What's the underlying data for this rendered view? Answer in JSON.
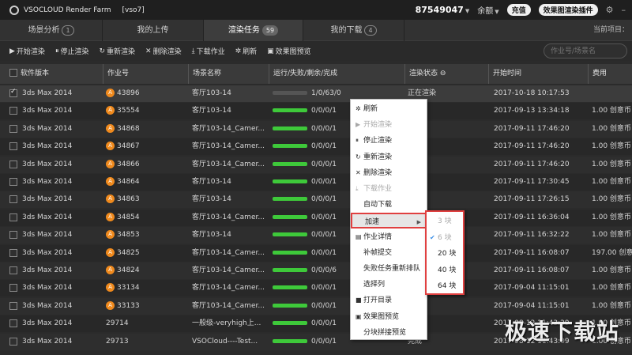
{
  "app": {
    "title": "VSOCLOUD Render Farm",
    "user_tag": "[vso7]"
  },
  "top": {
    "account": "87549047",
    "balance_label": "余额",
    "recharge": "充值",
    "plugin": "效果图渲染插件"
  },
  "tabs": [
    {
      "label": "场景分析",
      "count": "1"
    },
    {
      "label": "我的上传",
      "count": ""
    },
    {
      "label": "渲染任务",
      "count": "59"
    },
    {
      "label": "我的下载",
      "count": "4"
    }
  ],
  "current_project_label": "当前项目：",
  "toolbar": [
    {
      "icon": "▶",
      "label": "开始渲染"
    },
    {
      "icon": "⏸",
      "label": "停止渲染"
    },
    {
      "icon": "↻",
      "label": "重新渲染"
    },
    {
      "icon": "✕",
      "label": "删除渲染"
    },
    {
      "icon": "⤓",
      "label": "下载作业"
    },
    {
      "icon": "✲",
      "label": "刷新"
    },
    {
      "icon": "▣",
      "label": "效果图预览"
    }
  ],
  "search": {
    "placeholder": "作业号/场景名"
  },
  "columns": [
    "软件版本",
    "作业号",
    "场景名称",
    "运行/失败/剩余/完成",
    "渲染状态",
    "开始时间",
    "费用"
  ],
  "rows": [
    {
      "software": "3ds Max 2014",
      "badge": "A",
      "job": "43896",
      "scene": "客厅103-14",
      "progress": "1/0/63/0",
      "status": "正在渲染",
      "time": "2017-10-18 10:17:53",
      "cost": "",
      "checked": true,
      "bar_fill": 0.0
    },
    {
      "software": "3ds Max 2014",
      "badge": "A",
      "job": "35554",
      "scene": "客厅103-14",
      "progress": "0/0/0/1",
      "status": "",
      "time": "2017-09-13 13:34:18",
      "cost": "1.00 创意币",
      "checked": false,
      "bar_fill": 1.0
    },
    {
      "software": "3ds Max 2014",
      "badge": "A",
      "job": "34868",
      "scene": "客厅103-14_Camer...",
      "progress": "0/0/0/1",
      "status": "",
      "time": "2017-09-11 17:46:20",
      "cost": "1.00 创意币",
      "checked": false,
      "bar_fill": 1.0
    },
    {
      "software": "3ds Max 2014",
      "badge": "A",
      "job": "34867",
      "scene": "客厅103-14_Camer...",
      "progress": "0/0/0/1",
      "status": "",
      "time": "2017-09-11 17:46:20",
      "cost": "1.00 创意币",
      "checked": false,
      "bar_fill": 1.0
    },
    {
      "software": "3ds Max 2014",
      "badge": "A",
      "job": "34866",
      "scene": "客厅103-14_Camer...",
      "progress": "0/0/0/1",
      "status": "",
      "time": "2017-09-11 17:46:20",
      "cost": "1.00 创意币",
      "checked": false,
      "bar_fill": 1.0
    },
    {
      "software": "3ds Max 2014",
      "badge": "A",
      "job": "34864",
      "scene": "客厅103-14",
      "progress": "0/0/0/1",
      "status": "",
      "time": "2017-09-11 17:30:45",
      "cost": "1.00 创意币",
      "checked": false,
      "bar_fill": 1.0
    },
    {
      "software": "3ds Max 2014",
      "badge": "A",
      "job": "34863",
      "scene": "客厅103-14",
      "progress": "0/0/0/1",
      "status": "",
      "time": "2017-09-11 17:26:15",
      "cost": "1.00 创意币",
      "checked": false,
      "bar_fill": 1.0
    },
    {
      "software": "3ds Max 2014",
      "badge": "A",
      "job": "34854",
      "scene": "客厅103-14_Camer...",
      "progress": "0/0/0/1",
      "status": "",
      "time": "2017-09-11 16:36:04",
      "cost": "1.00 创意币",
      "checked": false,
      "bar_fill": 1.0
    },
    {
      "software": "3ds Max 2014",
      "badge": "A",
      "job": "34853",
      "scene": "客厅103-14",
      "progress": "0/0/0/1",
      "status": "",
      "time": "2017-09-11 16:32:22",
      "cost": "1.00 创意币",
      "checked": false,
      "bar_fill": 1.0
    },
    {
      "software": "3ds Max 2014",
      "badge": "A",
      "job": "34825",
      "scene": "客厅103-14_Camer...",
      "progress": "0/0/0/1",
      "status": "",
      "time": "2017-09-11 16:08:07",
      "cost": "197.00 创意币",
      "checked": false,
      "bar_fill": 1.0
    },
    {
      "software": "3ds Max 2014",
      "badge": "A",
      "job": "34824",
      "scene": "客厅103-14_Camer...",
      "progress": "0/0/0/6",
      "status": "",
      "time": "2017-09-11 16:08:07",
      "cost": "1.00 创意币",
      "checked": false,
      "bar_fill": 1.0
    },
    {
      "software": "3ds Max 2014",
      "badge": "A",
      "job": "33134",
      "scene": "客厅103-14_Camer...",
      "progress": "0/0/0/1",
      "status": "",
      "time": "2017-09-04 11:15:01",
      "cost": "1.00 创意币",
      "checked": false,
      "bar_fill": 1.0
    },
    {
      "software": "3ds Max 2014",
      "badge": "A",
      "job": "33133",
      "scene": "客厅103-14_Camer...",
      "progress": "0/0/0/1",
      "status": "",
      "time": "2017-09-04 11:15:01",
      "cost": "1.00 创意币",
      "checked": false,
      "bar_fill": 1.0
    },
    {
      "software": "3ds Max 2014",
      "badge": "",
      "job": "29714",
      "scene": "一般级-veryhigh上...",
      "progress": "0/0/0/1",
      "status": "",
      "time": "2017-08-12 11:43:29",
      "cost": "1.00 创意币",
      "checked": false,
      "bar_fill": 1.0
    },
    {
      "software": "3ds Max 2014",
      "badge": "",
      "job": "29713",
      "scene": "VSOCloud----Test...",
      "progress": "0/0/0/1",
      "status": "完成",
      "time": "2017-08-12 11:43:09",
      "cost": "1.00 创意币",
      "checked": false,
      "bar_fill": 1.0
    }
  ],
  "context_menu": [
    {
      "icon": "✲",
      "label": "刷新",
      "disabled": false
    },
    {
      "icon": "▶",
      "label": "开始渲染",
      "disabled": true
    },
    {
      "icon": "⏸",
      "label": "停止渲染",
      "disabled": false
    },
    {
      "icon": "↻",
      "label": "重新渲染",
      "disabled": false
    },
    {
      "icon": "✕",
      "label": "删除渲染",
      "disabled": false
    },
    {
      "icon": "⤓",
      "label": "下载作业",
      "disabled": true
    },
    {
      "icon": "",
      "label": "自动下载",
      "disabled": false
    },
    {
      "icon": "",
      "label": "加速",
      "disabled": false,
      "submenu": true
    },
    {
      "icon": "▤",
      "label": "作业详情",
      "disabled": false
    },
    {
      "icon": "",
      "label": "补帧提交",
      "disabled": false
    },
    {
      "icon": "",
      "label": "失败任务重新排队",
      "disabled": false
    },
    {
      "icon": "",
      "label": "选择列",
      "disabled": false
    },
    {
      "icon": "■",
      "label": "打开目录",
      "disabled": false
    },
    {
      "icon": "▣",
      "label": "效果图预览",
      "disabled": false
    },
    {
      "icon": "",
      "label": "分块拼接预览",
      "disabled": false
    }
  ],
  "submenu": [
    {
      "label": "3 块",
      "disabled": true,
      "checked": false
    },
    {
      "label": "6 块",
      "disabled": true,
      "checked": true
    },
    {
      "label": "20 块",
      "disabled": false,
      "checked": false
    },
    {
      "label": "40 块",
      "disabled": false,
      "checked": false
    },
    {
      "label": "64 块",
      "disabled": false,
      "checked": false
    }
  ],
  "watermark": "极速下载站"
}
